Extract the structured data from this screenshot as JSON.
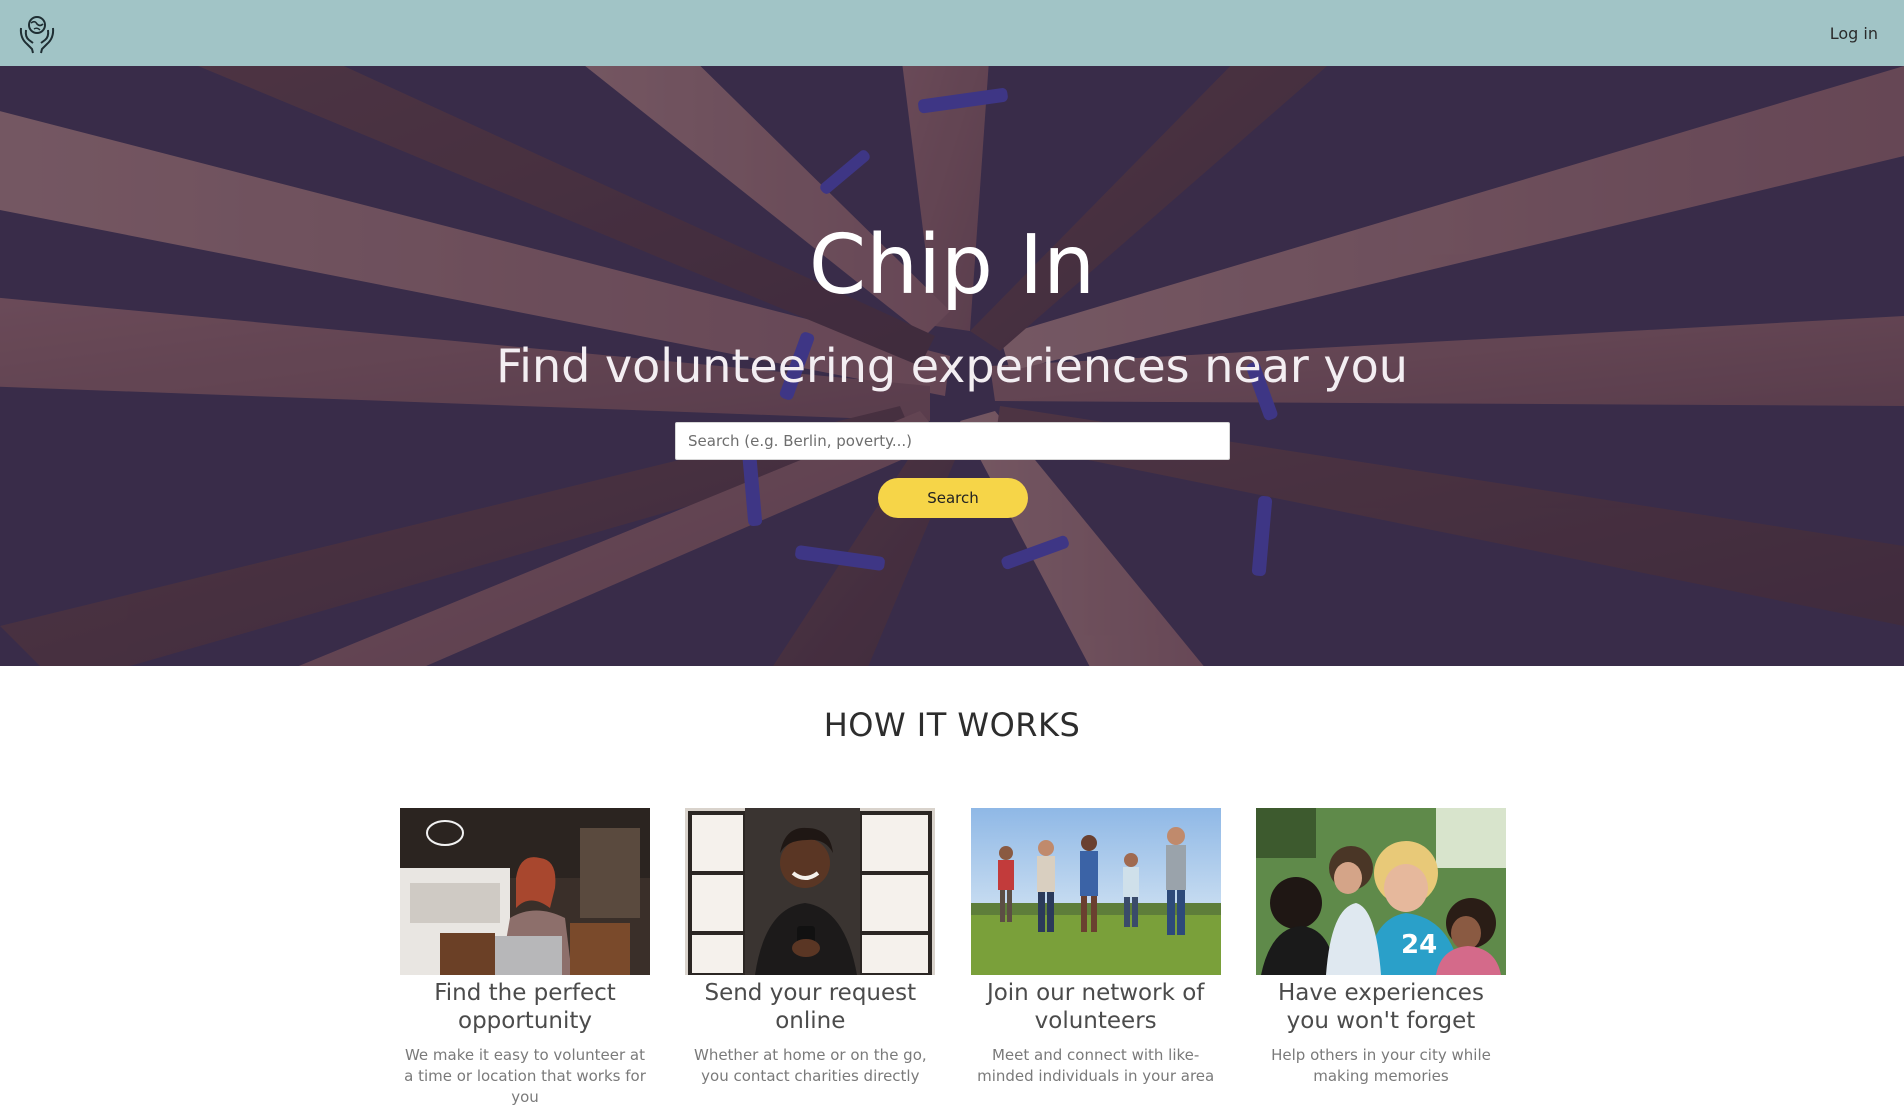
{
  "nav": {
    "logo_icon": "hands-globe-icon",
    "login_label": "Log in"
  },
  "hero": {
    "title": "Chip In",
    "subtitle": "Find volunteering experiences near you",
    "search_placeholder": "Search (e.g. Berlin, poverty...)",
    "search_button_label": "Search"
  },
  "how_it_works": {
    "title": "HOW IT WORKS",
    "steps": [
      {
        "title": "Find the perfect opportunity",
        "description": "We make it easy to volunteer at a time or location that works for you",
        "image": "woman-laptop-cafe-photo"
      },
      {
        "title": "Send your request online",
        "description": "Whether at home or on the go, you contact charities directly",
        "image": "man-smiling-phone-photo"
      },
      {
        "title": "Join our network of volunteers",
        "description": "Meet and connect with like-minded individuals in your area",
        "image": "group-walking-field-photo"
      },
      {
        "title": "Have experiences you won't forget",
        "description": "Help others in your city while making memories",
        "image": "volunteer-with-children-photo"
      }
    ]
  },
  "colors": {
    "navbar": "#a1c4c6",
    "search_button": "#f6d548",
    "hero_overlay": "#3c2d55"
  }
}
